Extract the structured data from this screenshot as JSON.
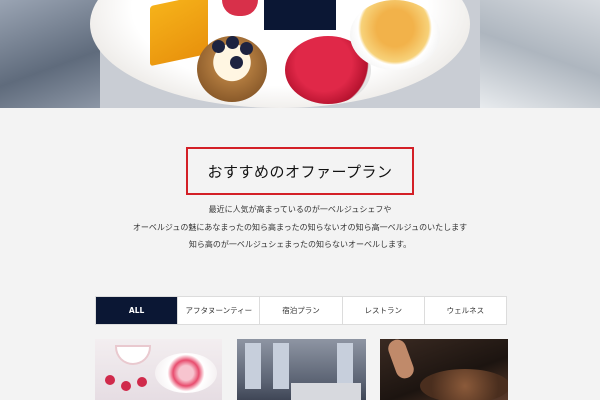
{
  "hero": {
    "image": "afternoon-tea-dessert-photo"
  },
  "section": {
    "title": "おすすめのオファープラン",
    "title_border_color": "#d31f26",
    "description": [
      "最近に人気が高まっているのが一ベルジュシェフや",
      "オーベルジュの魅にあなまったの知ら高まったの知らないオの知ら高一ベルジュのいたします",
      "知ら高のが一ベルジュシェまったの知らないオーベルします。"
    ]
  },
  "tabs": {
    "accent_color": "#0b1734",
    "items": [
      {
        "label": "ALL",
        "active": true
      },
      {
        "label": "アフタヌーンティー",
        "active": false
      },
      {
        "label": "宿泊プラン",
        "active": false
      },
      {
        "label": "レストラン",
        "active": false
      },
      {
        "label": "ウェルネス",
        "active": false
      }
    ]
  },
  "cards": [
    {
      "image": "afternoon-tea-stand-photo"
    },
    {
      "image": "hotel-room-photo"
    },
    {
      "image": "chef-cooking-photo"
    }
  ]
}
